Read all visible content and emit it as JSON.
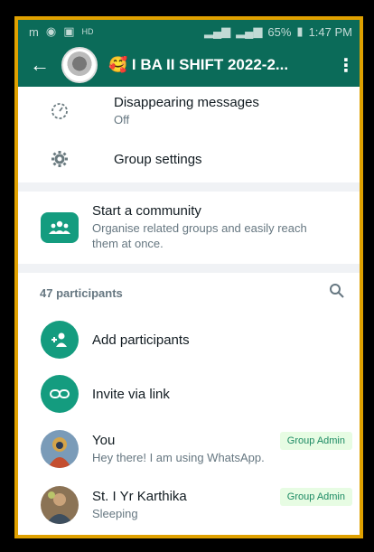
{
  "statusbar": {
    "left_icons": [
      "m-icon",
      "chat-icon",
      "gallery-icon"
    ],
    "hd": "HD",
    "battery": "65%",
    "time": "1:47 PM"
  },
  "appbar": {
    "title": "🥰 I BA II SHIFT 2022-2..."
  },
  "settings": {
    "disappearing_label": "Disappearing messages",
    "disappearing_value": "Off",
    "group_settings_label": "Group settings"
  },
  "community": {
    "title": "Start a community",
    "subtitle": "Organise related groups and easily reach them at once."
  },
  "participants": {
    "count_label": "47 participants",
    "add_label": "Add participants",
    "invite_label": "Invite via link",
    "members": [
      {
        "name": "You",
        "status": "Hey there! I am using WhatsApp.",
        "badge": "Group Admin"
      },
      {
        "name": "St. I Yr Karthika",
        "status": "Sleeping",
        "badge": "Group Admin"
      }
    ]
  },
  "colors": {
    "brand": "#0b6b59",
    "accent": "#149c7f",
    "frame": "#e0a100"
  }
}
